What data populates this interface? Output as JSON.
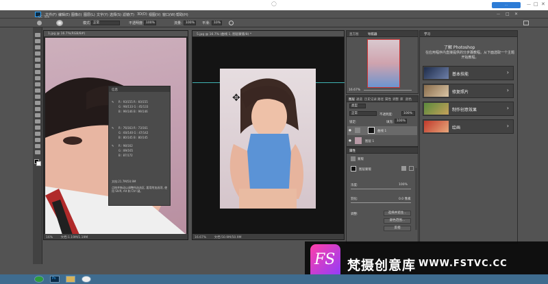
{
  "window": {
    "loading_glyph": "◌",
    "share_button": "...",
    "controls": [
      "—",
      "□",
      "✕"
    ],
    "app_name": "CC Talk"
  },
  "menu": [
    "文件(F)",
    "编辑(E)",
    "图像(I)",
    "图层(L)",
    "文字(Y)",
    "选择(S)",
    "滤镜(T)",
    "3D(D)",
    "视图(V)",
    "窗口(W)",
    "帮助(H)"
  ],
  "options": {
    "mode_label": "模式:",
    "mode_value": "正常",
    "opacity_label": "不透明度:",
    "opacity_value": "100%",
    "flow_label": "流量:",
    "flow_value": "100%",
    "smooth_label": "平滑:",
    "smooth_value": "10%"
  },
  "doc1": {
    "tab": "1.jpg @ 16.7%(RGB/8#)",
    "zoom": "16%",
    "size": "文档:1.19M/1.19M"
  },
  "doc2": {
    "tab": "5.jpg @ 16.7% (曲线 1, 图层蒙版/8) *",
    "zoom": "16.67%",
    "size": "文档:50.9M/50.9M"
  },
  "info": {
    "title": "信息",
    "rows": [
      "R : 93/155   R : 60/155",
      "G : 90/133   G : 45/133",
      "B : 99/146   B : 99/146",
      "R : 76/163   R : 73/161",
      "G : 60/140   G : 47/142",
      "B : 80/145   B : 80/145",
      "R : 98/162",
      "G : 89/165",
      "B : 87/172"
    ],
    "doc_size": "文档:21.7M/50.9M",
    "hint": "点按并拖动以调整所选选区, 要用附加选项, 使用 Shift, Alt 和 Ctrl 键。"
  },
  "navigator": {
    "tabs": [
      "直方图",
      "导航器"
    ],
    "zoom": "16.67%"
  },
  "layers": {
    "tabs": [
      "图层",
      "通道",
      "历史记录",
      "路径",
      "属性",
      "调整",
      "库",
      "颜色"
    ],
    "kind": "类型",
    "blend": "正常",
    "opacity_label": "不透明度:",
    "opacity": "100%",
    "lock_label": "锁定:",
    "fill_label": "填充:",
    "fill": "100%",
    "items": [
      {
        "name": "曲线 1"
      },
      {
        "name": "图层 1"
      }
    ]
  },
  "properties": {
    "title": "属性",
    "section": "蒙版",
    "mask_type": "图层蒙版",
    "density_label": "浓度:",
    "density": "100%",
    "feather_label": "羽化:",
    "feather": "0.0 像素",
    "adjust_label": "调整:",
    "buttons": [
      "选择并遮住...",
      "颜色范围...",
      "反相"
    ]
  },
  "learn": {
    "tab": "学习",
    "heading": "了解 Photoshop",
    "desc": "在应用程序内直接提供的分步骤教程。从下面选取一个主题开始教程。",
    "cards": [
      {
        "label": "基本技能"
      },
      {
        "label": "修复照片"
      },
      {
        "label": "制作创意效果"
      },
      {
        "label": "绘画"
      }
    ],
    "chevron": "›"
  },
  "watermark": {
    "logo": "FS",
    "text": "梵摄创意库",
    "url": "WWW.FSTVC.CC"
  },
  "taskbar": {
    "ps_label": "Ps"
  }
}
